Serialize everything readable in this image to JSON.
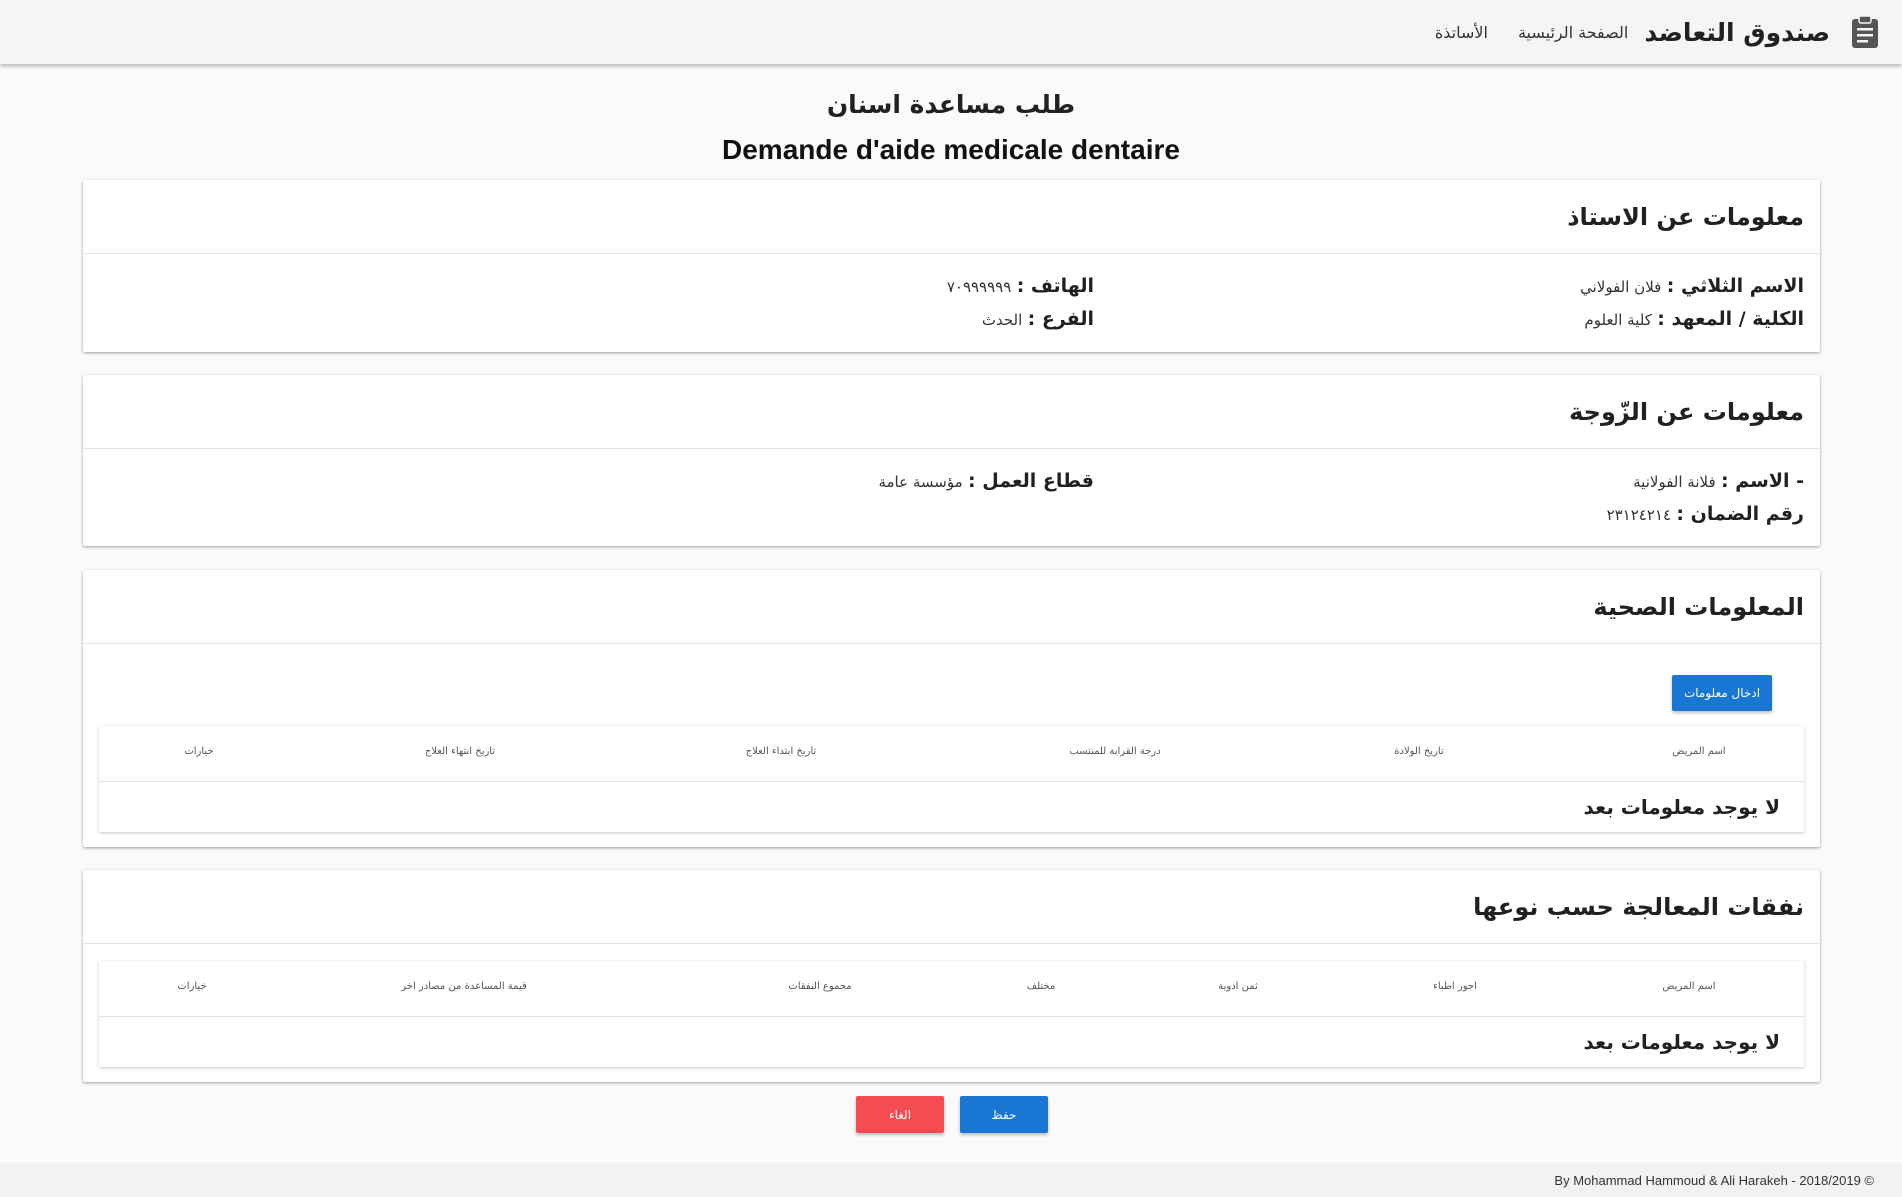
{
  "nav": {
    "brand": "صندوق التعاضد",
    "home": "الصفحة الرئيسية",
    "teachers": "الأساتذة",
    "brand_icon": "clipboard-icon"
  },
  "page": {
    "title_ar": "طلب مساعدة اسنان",
    "title_fr": "Demande d'aide medicale dentaire"
  },
  "teacher": {
    "header": "معلومات عن الاستاذ",
    "name_label": "الاسم الثلاثي :",
    "name_value": "فلان الفولاني",
    "faculty_label": "الكلية / المعهد :",
    "faculty_value": "كلية العلوم",
    "phone_label": "الهاتف :",
    "phone_value": "٧٠٩٩٩٩٩٩",
    "branch_label": "الفرع :",
    "branch_value": "الحدث"
  },
  "spouse": {
    "header": "معلومات عن الزّوجة",
    "name_label": "- الاسم :",
    "name_value": "فلانة الفولانية",
    "insurance_label": "رقم الضمان :",
    "insurance_value": "٢٣١٢٤٢١٤",
    "sector_label": "قطاع العمل :",
    "sector_value": "مؤسسة عامة"
  },
  "health": {
    "header": "المعلومات الصحية",
    "add_button": "ادخال معلومات",
    "columns": [
      "اسم المريض",
      "تاريخ الولادة",
      "درجة القرابة للمنتسب",
      "تاريخ ابتداء العلاج",
      "تاريخ انتهاء العلاج",
      "خيارات"
    ],
    "empty": "لا يوجد معلومات بعد"
  },
  "expenses": {
    "header": "نفقات المعالجة حسب نوعها",
    "columns": [
      "اسم المريض",
      "اجور اطباء",
      "ثمن ادوية",
      "مختلف",
      "مجموع النفقات",
      "قيمة المساعدة من مصادر اخر",
      "خيارات"
    ],
    "empty": "لا يوجد معلومات بعد"
  },
  "actions": {
    "save": "حفظ",
    "cancel": "الغاء"
  },
  "footer": {
    "text": "By Mohammad Hammoud & Ali Harakeh - 2018/2019 ©"
  },
  "colors": {
    "primary": "#1976d2",
    "danger": "#f44c52"
  }
}
